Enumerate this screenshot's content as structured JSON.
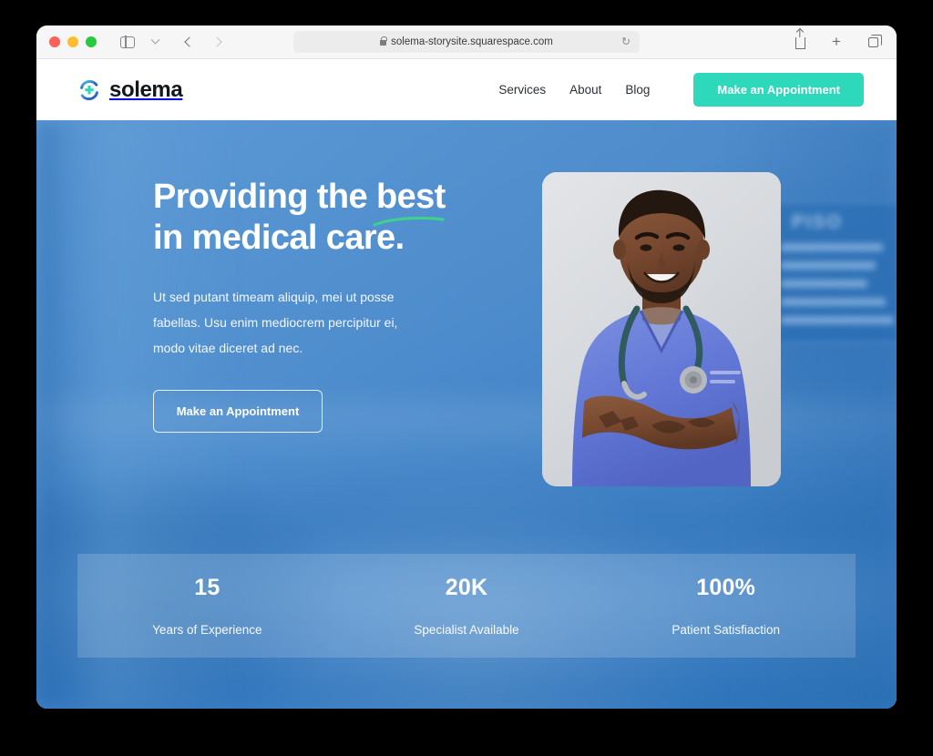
{
  "browser": {
    "traffic_lights": [
      {
        "name": "close",
        "color": "#FF5F57"
      },
      {
        "name": "minimize",
        "color": "#FEBC2E"
      },
      {
        "name": "maximize",
        "color": "#28C840"
      }
    ],
    "sidebar_toggle_icon": "sidebar-icon",
    "dropdown_icon": "chevron-down-icon",
    "back_icon": "chevron-left-icon",
    "forward_icon": "chevron-right-icon",
    "url": "solema-storysite.squarespace.com",
    "lock_icon": "lock-icon",
    "reload_icon": "reload-icon",
    "reload_glyph": "↻",
    "share_icon": "share-icon",
    "new_tab_icon": "plus-icon",
    "new_tab_glyph": "+",
    "tabs_overview_icon": "copy-tabs-icon"
  },
  "site": {
    "brand": {
      "name": "solema",
      "logo_icon": "solema-medical-cross-logo",
      "logo_cross_color": "#2ED8BB",
      "logo_swoosh_color": "#2F6FD0"
    },
    "nav": [
      {
        "label": "Services"
      },
      {
        "label": "About"
      },
      {
        "label": "Blog"
      }
    ],
    "header_cta": {
      "label": "Make an Appointment",
      "background": "#2ED8BB",
      "text_color": "#FFFFFF"
    }
  },
  "hero": {
    "title_line_1_pre": "Providing the ",
    "title_line_1_highlight": "best",
    "title_line_2": "in medical care.",
    "underline_color": "#3FCF8E",
    "paragraph": "Ut sed putant timeam aliquip, mei ut posse fabellas. Usu enim mediocrem percipitur ei, modo vitae diceret ad nec.",
    "cta": {
      "label": "Make an Appointment"
    },
    "portrait_alt": "smiling-male-nurse-in-blue-scrubs-with-stethoscope-arms-crossed",
    "background_alt": "blurred-hospital-corridor",
    "background_sign_text": "PISO",
    "background_color": "#4F8FD0"
  },
  "stats": [
    {
      "value": "15",
      "label": "Years of Experience"
    },
    {
      "value": "20K",
      "label": "Specialist Available"
    },
    {
      "value": "100%",
      "label": "Patient Satisfiaction"
    }
  ]
}
